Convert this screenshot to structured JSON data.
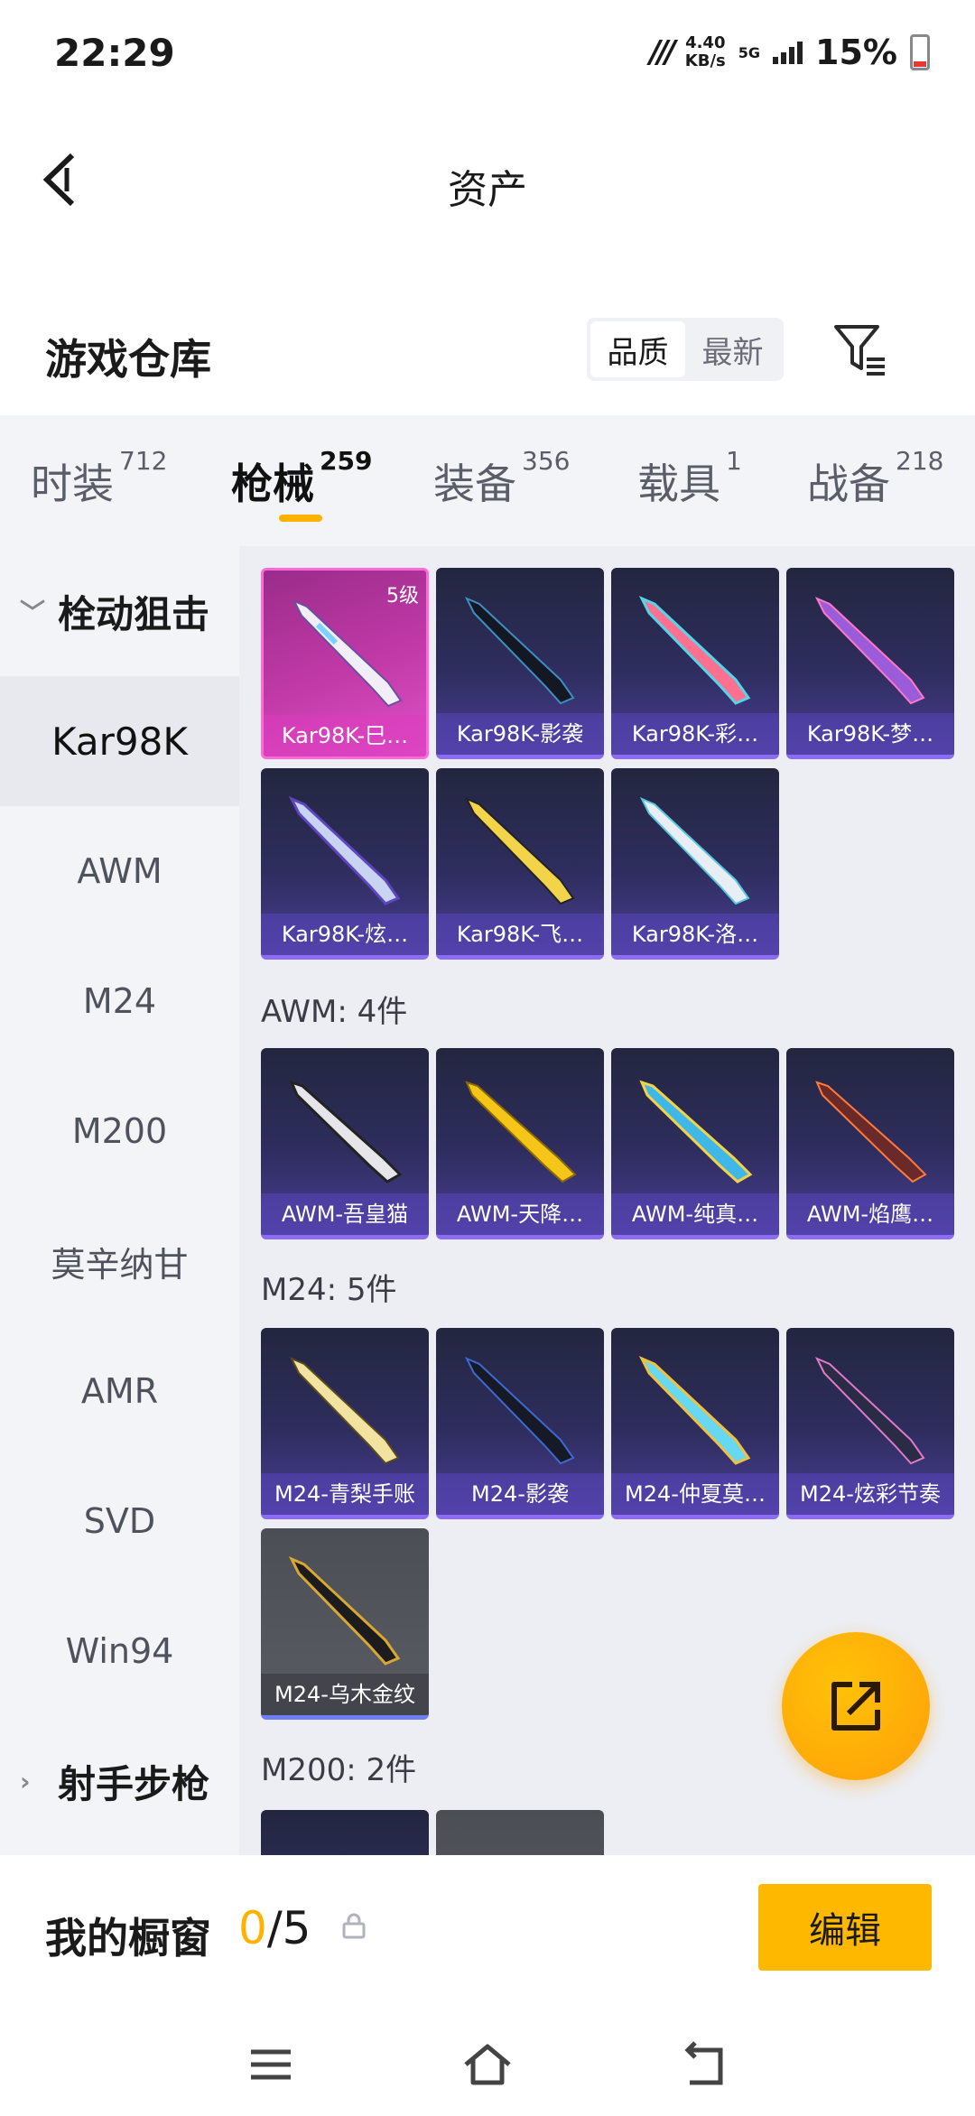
{
  "status": {
    "time": "22:29",
    "speed_value": "4.40",
    "speed_unit": "KB/s",
    "net": "5G",
    "battery": "15%"
  },
  "header": {
    "title": "资产"
  },
  "section": {
    "title": "游戏仓库",
    "sort_quality": "品质",
    "sort_newest": "最新"
  },
  "tabs": [
    {
      "label": "时装",
      "count": "712"
    },
    {
      "label": "枪械",
      "count": "259"
    },
    {
      "label": "装备",
      "count": "356"
    },
    {
      "label": "载具",
      "count": "1"
    },
    {
      "label": "战备",
      "count": "218"
    }
  ],
  "sidebar": {
    "group1": "栓动狙击",
    "items": [
      "Kar98K",
      "AWM",
      "M24",
      "M200",
      "莫辛纳甘",
      "AMR",
      "SVD",
      "Win94"
    ],
    "group2": "射手步枪"
  },
  "groups": {
    "awm_label": "AWM: 4件",
    "m24_label": "M24: 5件",
    "m200_label": "M200: 2件"
  },
  "cards": {
    "kar": [
      "Kar98K-巳…",
      "Kar98K-影袭",
      "Kar98K-彩…",
      "Kar98K-梦…",
      "Kar98K-炫…",
      "Kar98K-飞…",
      "Kar98K-洛…"
    ],
    "kar_level": "5级",
    "awm": [
      "AWM-吾皇猫",
      "AWM-天降…",
      "AWM-纯真…",
      "AWM-焰鹰…"
    ],
    "m24": [
      "M24-青梨手账",
      "M24-影袭",
      "M24-仲夏莫…",
      "M24-炫彩节奏",
      "M24-乌木金纹"
    ]
  },
  "bottom": {
    "label": "我的橱窗",
    "current": "0",
    "total": "/5",
    "edit": "编辑"
  },
  "colors": {
    "accent": "#ffb800",
    "card_purple": "#4a3e94",
    "card_gold": "#c23aa8"
  }
}
